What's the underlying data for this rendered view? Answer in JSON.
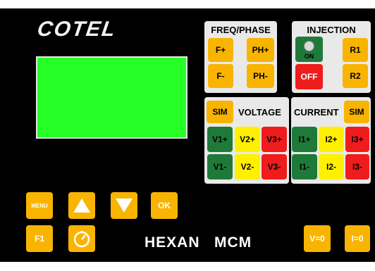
{
  "brand": {
    "logo": "COTEL",
    "model": "HEXAN   MCM"
  },
  "freq_phase": {
    "title": "FREQ/PHASE",
    "f_plus": "F+",
    "ph_plus": "PH+",
    "f_minus": "F-",
    "ph_minus": "PH-"
  },
  "injection": {
    "title": "INJECTION",
    "on": "ON",
    "off": "OFF",
    "r1": "R1",
    "r2": "R2"
  },
  "voltage": {
    "sim": "SIM",
    "title": "VOLTAGE",
    "v1p": "V1+",
    "v2p": "V2+",
    "v3p": "V3+",
    "v1m": "V1-",
    "v2m": "V2-",
    "v3m": "V3-"
  },
  "current": {
    "title": "CURRENT",
    "sim": "SIM",
    "i1p": "I1+",
    "i2p": "I2+",
    "i3p": "I3+",
    "i1m": "I1-",
    "i2m": "I2-",
    "i3m": "I3-"
  },
  "keys": {
    "menu": "MENU",
    "ok": "OK",
    "f1": "F1",
    "v0": "V=0",
    "i0": "I=0"
  },
  "colors": {
    "orange": "#f8b400",
    "green": "#1f7a3a",
    "yellow": "#fff000",
    "red": "#ee1c1c",
    "screen": "#26ff26"
  }
}
